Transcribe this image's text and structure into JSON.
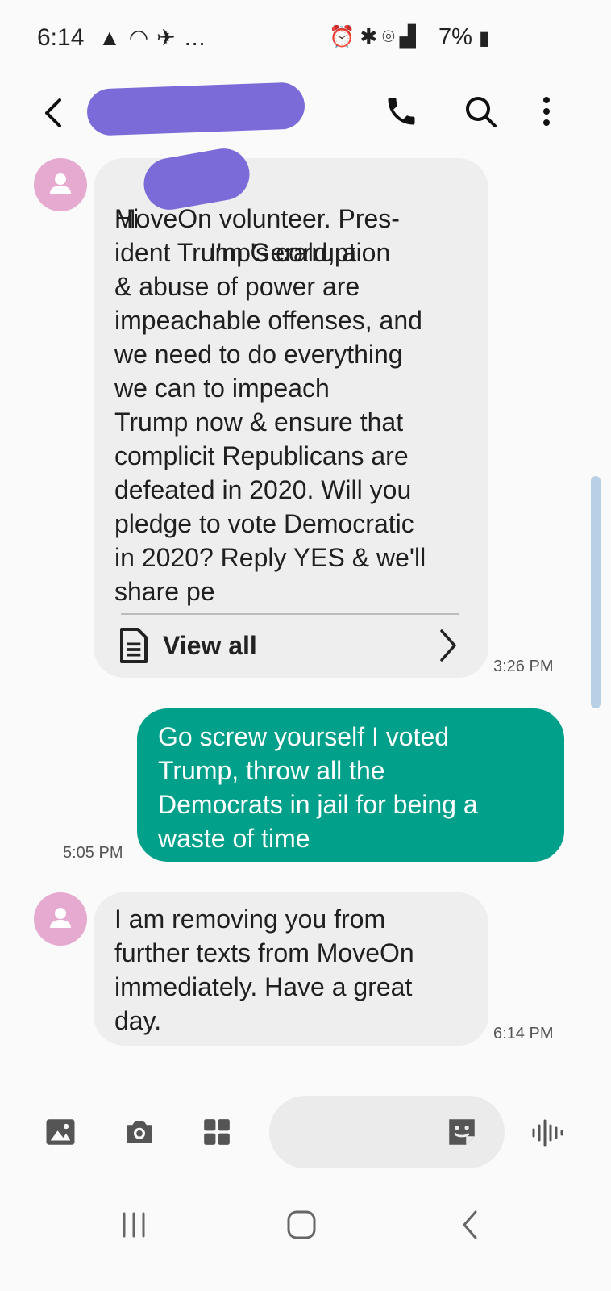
{
  "status_bar": {
    "time": "6:14",
    "battery": "7%",
    "left_icons": [
      "navigation-icon",
      "wifi-icon",
      "airplane-bolt-icon",
      "more-dots-icon"
    ],
    "right_icons": [
      "alarm-icon",
      "bluetooth-icon",
      "location-icon",
      "lte-signal-icon",
      "battery-charging-icon"
    ]
  },
  "header": {
    "contact_name": "",
    "actions": [
      "phone-icon",
      "search-icon",
      "more-vert-icon"
    ]
  },
  "messages": [
    {
      "direction": "incoming",
      "text_prefix": "Hi",
      "text_after_redaction": "I'm Gerald, a",
      "text": "MoveOn volunteer. Pres-\nident Trump's corruption\n& abuse of power are\nimpeachable offenses, and\nwe need to do everything\nwe can to impeach\nTrump now & ensure that\ncomplicit Republicans are\ndefeated in 2020. Will you\npledge to vote Democratic\nin 2020? Reply YES & we'll\nshare pe",
      "view_all_label": "View all",
      "timestamp": "3:26 PM"
    },
    {
      "direction": "outgoing",
      "text": "Go screw yourself I voted\nTrump, throw all the\nDemocrats in jail for being a\nwaste of time",
      "timestamp": "5:05 PM"
    },
    {
      "direction": "incoming",
      "text": "I am removing you from\nfurther texts from MoveOn\nimmediately. Have a great\nday.",
      "timestamp": "6:14 PM"
    }
  ],
  "composer": {
    "buttons": [
      "gallery-icon",
      "camera-icon",
      "apps-grid-icon"
    ],
    "input_placeholder": "",
    "sticker_icon": "sticker-icon",
    "voice_icon": "voice-wave-icon"
  },
  "colors": {
    "outgoing_bubble": "#00a08a",
    "incoming_bubble": "#eeeeee",
    "avatar": "#e6a9cf",
    "redaction": "#7a6bd9"
  }
}
